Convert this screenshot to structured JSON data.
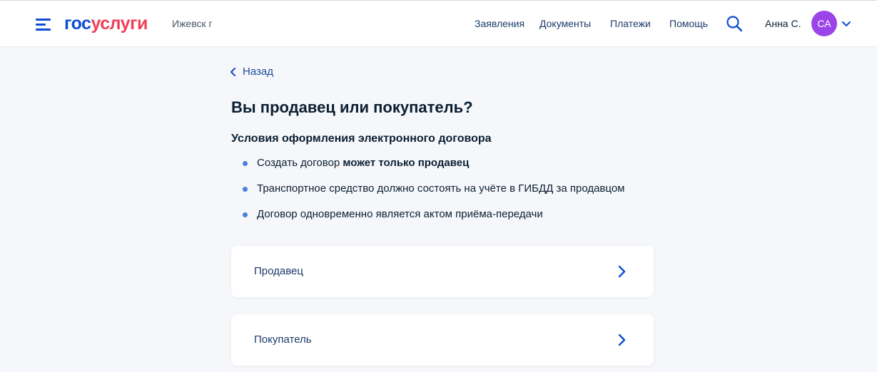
{
  "header": {
    "logo_part1": "гос",
    "logo_part2": "услуги",
    "city": "Ижевск г",
    "nav": [
      "Заявления",
      "Документы",
      "Платежи",
      "Помощь"
    ],
    "user_name": "Анна С.",
    "avatar_initials": "СА",
    "icons": {
      "menu": "menu-icon",
      "search": "search-icon",
      "dropdown": "chevron-down-icon"
    }
  },
  "back_label": "Назад",
  "title": "Вы продавец или покупатель?",
  "conditions": {
    "heading": "Условия оформления электронного договора",
    "items": [
      {
        "text": "Создать договор ",
        "bold": "может только продавец"
      },
      {
        "text": "Транспортное средство должно состоять на учёте в ГИБДД за продавцом",
        "bold": ""
      },
      {
        "text": "Договор одновременно является актом приёма-передачи",
        "bold": ""
      }
    ]
  },
  "options": [
    {
      "label": "Продавец"
    },
    {
      "label": "Покупатель"
    }
  ],
  "colors": {
    "accent": "#0d4cd3",
    "brand_red": "#ee3f58",
    "avatar": "#9b44e8",
    "bullet": "#4a7fe0",
    "background": "#f5f7fa"
  }
}
